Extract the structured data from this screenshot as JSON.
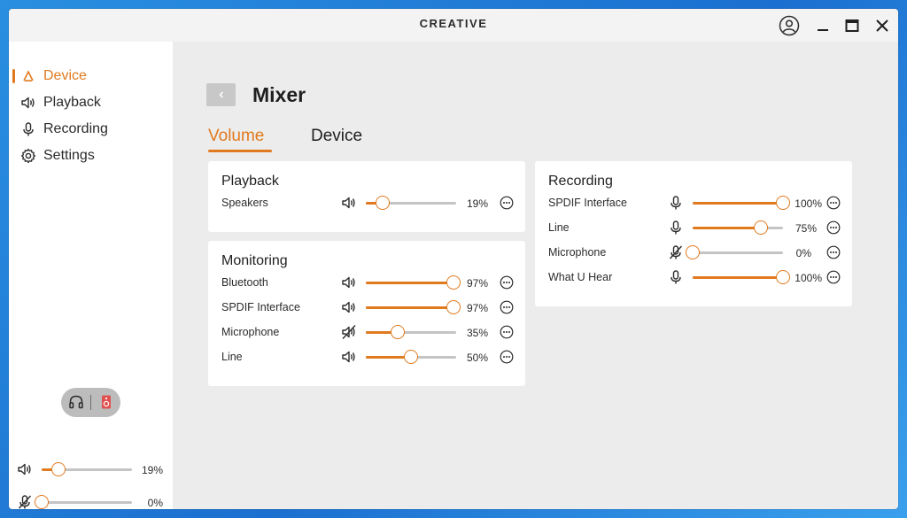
{
  "app": {
    "brand": "CREATIVE"
  },
  "sidebar": {
    "items": [
      {
        "label": "Device",
        "icon": "creative-logo-icon",
        "active": true
      },
      {
        "label": "Playback",
        "icon": "speaker-icon",
        "active": false
      },
      {
        "label": "Recording",
        "icon": "microphone-icon",
        "active": false
      },
      {
        "label": "Settings",
        "icon": "gear-icon",
        "active": false
      }
    ],
    "output_toggle": {
      "options": [
        "headphones",
        "speaker"
      ],
      "selected": "speaker"
    },
    "master_volume": {
      "value": 19,
      "label": "19%",
      "muted": false
    },
    "master_mic": {
      "value": 0,
      "label": "0%",
      "muted": true
    }
  },
  "main": {
    "title": "Mixer",
    "tabs": [
      {
        "label": "Volume",
        "active": true
      },
      {
        "label": "Device",
        "active": false
      }
    ],
    "playback": {
      "title": "Playback",
      "rows": [
        {
          "name": "Speakers",
          "value": 19,
          "label": "19%",
          "muted": false
        }
      ]
    },
    "monitoring": {
      "title": "Monitoring",
      "rows": [
        {
          "name": "Bluetooth",
          "value": 97,
          "label": "97%",
          "muted": false
        },
        {
          "name": "SPDIF Interface",
          "value": 97,
          "label": "97%",
          "muted": false
        },
        {
          "name": "Microphone",
          "value": 35,
          "label": "35%",
          "muted": true
        },
        {
          "name": "Line",
          "value": 50,
          "label": "50%",
          "muted": false
        }
      ]
    },
    "recording": {
      "title": "Recording",
      "rows": [
        {
          "name": "SPDIF Interface",
          "value": 100,
          "label": "100%",
          "muted": false
        },
        {
          "name": "Line",
          "value": 75,
          "label": "75%",
          "muted": false
        },
        {
          "name": "Microphone",
          "value": 0,
          "label": "0%",
          "muted": true
        },
        {
          "name": "What U Hear",
          "value": 100,
          "label": "100%",
          "muted": false
        }
      ]
    }
  },
  "colors": {
    "accent": "#e07a1f",
    "track": "#c4c4c4",
    "background": "#ececec",
    "card": "#ffffff",
    "toggle_speaker": "#e0504f"
  }
}
